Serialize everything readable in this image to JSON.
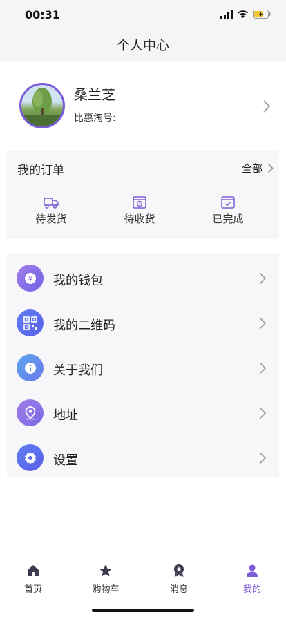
{
  "status": {
    "time": "00:31"
  },
  "nav": {
    "title": "个人中心"
  },
  "profile": {
    "name": "桑兰芝",
    "id_label": "比惠淘号:"
  },
  "orders": {
    "title": "我的订单",
    "all_label": "全部",
    "items": [
      {
        "label": "待发货",
        "icon": "truck-icon"
      },
      {
        "label": "待收货",
        "icon": "clock-box-icon"
      },
      {
        "label": "已完成",
        "icon": "check-box-icon"
      }
    ]
  },
  "menu": [
    {
      "label": "我的钱包",
      "icon": "wallet-icon"
    },
    {
      "label": "我的二维码",
      "icon": "qrcode-icon"
    },
    {
      "label": "关于我们",
      "icon": "info-icon"
    },
    {
      "label": "地址",
      "icon": "location-icon"
    },
    {
      "label": "设置",
      "icon": "settings-icon"
    }
  ],
  "tabs": [
    {
      "label": "首页",
      "icon": "home-icon"
    },
    {
      "label": "购物车",
      "icon": "star-icon"
    },
    {
      "label": "消息",
      "icon": "badge-icon"
    },
    {
      "label": "我的",
      "icon": "user-icon",
      "active": true
    }
  ],
  "colors": {
    "accent": "#7b5cd6",
    "icon_gradient_start": "#8a6ee0",
    "icon_gradient_end": "#4f7af0"
  }
}
